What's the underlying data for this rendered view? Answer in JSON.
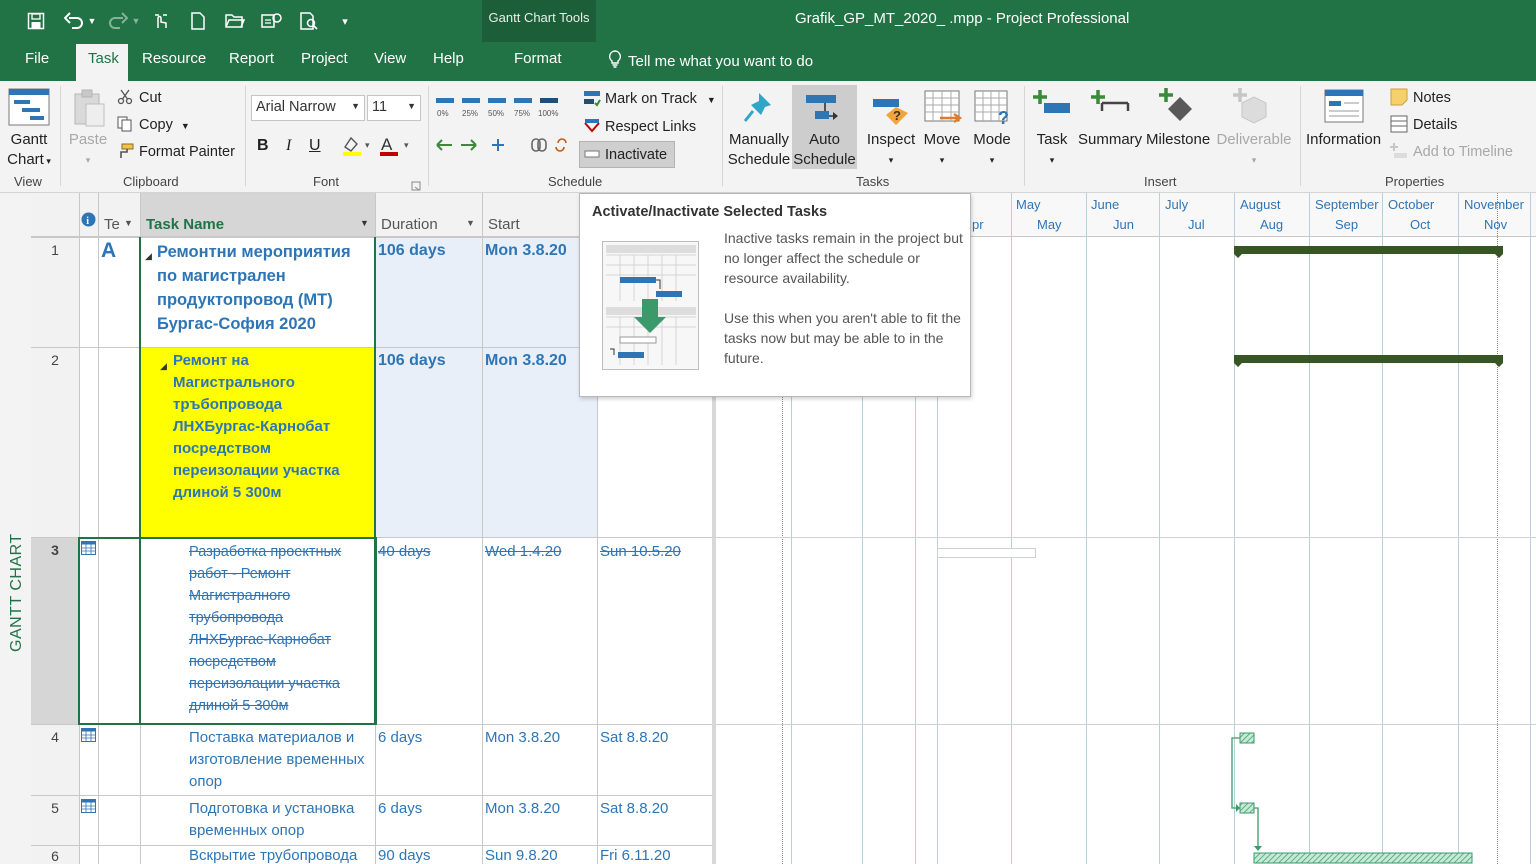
{
  "window": {
    "title": "Grafik_GP_MT_2020_ .mpp  -  Project Professional",
    "contextual_group": "Gantt Chart Tools"
  },
  "qat": {
    "save": "save-icon",
    "undo": "undo-icon",
    "redo": "redo-icon",
    "more": "▾"
  },
  "menu": {
    "tabs": [
      "File",
      "Task",
      "Resource",
      "Report",
      "Project",
      "View",
      "Help",
      "Format"
    ],
    "active": "Task",
    "tell_me": "Tell me what you want to do"
  },
  "ribbon": {
    "view": {
      "gantt_chart_line1": "Gantt",
      "gantt_chart_line2": "Chart",
      "label": "View"
    },
    "clipboard": {
      "paste": "Paste",
      "cut": "Cut",
      "copy": "Copy",
      "format_painter": "Format Painter",
      "label": "Clipboard"
    },
    "font": {
      "family": "Arial Narrow",
      "size": "11",
      "bold": "B",
      "italic": "I",
      "underline": "U",
      "font_color": "A",
      "label": "Font"
    },
    "schedule": {
      "pct": [
        "0%",
        "25%",
        "50%",
        "75%",
        "100%"
      ],
      "mark_on_track": "Mark on Track",
      "respect_links": "Respect Links",
      "inactivate": "Inactivate",
      "label": "Schedule"
    },
    "tasks": {
      "manually_line1": "Manually",
      "manually_line2": "Schedule",
      "auto_line1": "Auto",
      "auto_line2": "Schedule",
      "inspect": "Inspect",
      "move": "Move",
      "mode": "Mode",
      "label": "Tasks"
    },
    "insert": {
      "task": "Task",
      "summary": "Summary",
      "milestone": "Milestone",
      "deliverable": "Deliverable",
      "label": "Insert"
    },
    "properties": {
      "information": "Information",
      "notes": "Notes",
      "details": "Details",
      "add_to_timeline": "Add to Timeline",
      "label": "Properties"
    }
  },
  "view_label": "GANTT CHART",
  "table": {
    "headers": {
      "info": "i",
      "mode": "Te",
      "task_name": "Task Name",
      "duration": "Duration",
      "start": "Start"
    },
    "rows": [
      {
        "id": "1",
        "indicator": "A",
        "name_lines": [
          "Ремонтни мероприятия",
          "по магистрален",
          "продуктопровод (МТ)",
          "Бургас-София 2020"
        ],
        "duration": "106 days",
        "start": "Mon 3.8.20",
        "finish": ""
      },
      {
        "id": "2",
        "indicator": "",
        "name_lines": [
          "Ремонт на Магистрального",
          "тръбопровода",
          "ЛНХБургас-Карнобат",
          "посредством",
          "переизолации участка",
          "длиной 5 300м"
        ],
        "duration": "106 days",
        "start": "Mon 3.8.20",
        "finish": ""
      },
      {
        "id": "3",
        "indicator": "",
        "name_lines": [
          "Разработка проектных",
          "работ - Ремонт",
          "Магистралного",
          "трубопровода",
          "ЛНХБургас-Карнобат",
          "посредством",
          "переизолации участка",
          "длиной 5 300м"
        ],
        "duration": "40 days",
        "start": "Wed 1.4.20",
        "finish": "Sun 10.5.20"
      },
      {
        "id": "4",
        "indicator": "",
        "name_lines": [
          "Поставка материалов и",
          "изготовление временных",
          "опор"
        ],
        "duration": "6 days",
        "start": "Mon 3.8.20",
        "finish": "Sat 8.8.20"
      },
      {
        "id": "5",
        "indicator": "",
        "name_lines": [
          "Подготовка и установка",
          "временных опор"
        ],
        "duration": "6 days",
        "start": "Mon 3.8.20",
        "finish": "Sat 8.8.20"
      },
      {
        "id": "6",
        "indicator": "",
        "name_lines": [
          "Вскрытие трубопровода"
        ],
        "duration": "90 days",
        "start": "Sun 9.8.20",
        "finish": "Fri 6.11.20"
      }
    ]
  },
  "timeline": {
    "months_top": [
      "May",
      "June",
      "July",
      "August",
      "September",
      "October",
      "November"
    ],
    "months_bottom": [
      "pr",
      "May",
      "Jun",
      "Jul",
      "Aug",
      "Sep",
      "Oct",
      "Nov"
    ]
  },
  "tooltip": {
    "title": "Activate/Inactivate Selected Tasks",
    "p1": "Inactive tasks remain in the project but no longer affect the schedule or resource availability.",
    "p2": "Use this when you aren't able to fit the tasks now but may be able to in the future."
  },
  "colors": {
    "brand": "#217346",
    "link_blue": "#2e75b6",
    "summary_bar": "#375623",
    "highlight": "#ffff00",
    "task_bar": "#5fbf8f"
  }
}
